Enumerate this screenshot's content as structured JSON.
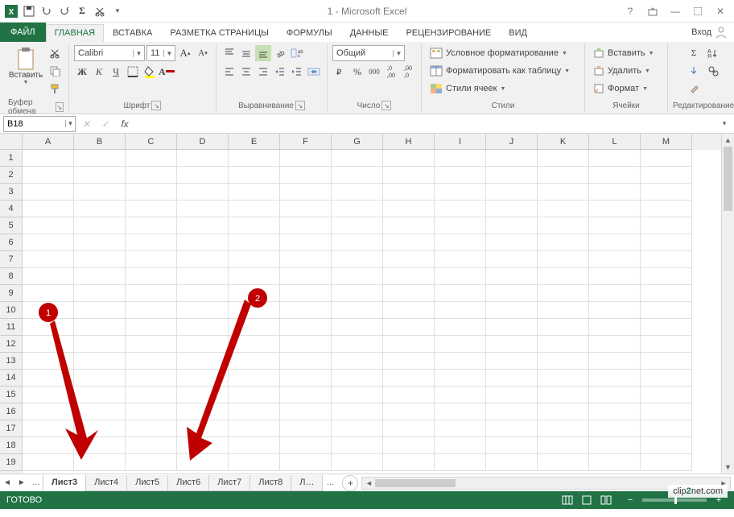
{
  "title": "1 - Microsoft Excel",
  "signin": "Вход",
  "tabs": {
    "file": "ФАЙЛ",
    "items": [
      "ГЛАВНАЯ",
      "ВСТАВКА",
      "РАЗМЕТКА СТРАНИЦЫ",
      "ФОРМУЛЫ",
      "ДАННЫЕ",
      "РЕЦЕНЗИРОВАНИЕ",
      "ВИД"
    ],
    "active": 0
  },
  "ribbon": {
    "clipboard": {
      "paste": "Вставить",
      "label": "Буфер обмена"
    },
    "font": {
      "name": "Calibri",
      "size": "11",
      "bold": "Ж",
      "italic": "К",
      "underline": "Ч",
      "label": "Шрифт"
    },
    "align": {
      "label": "Выравнивание"
    },
    "number": {
      "format": "Общий",
      "label": "Число"
    },
    "styles": {
      "cond": "Условное форматирование",
      "table": "Форматировать как таблицу",
      "cell": "Стили ячеек",
      "label": "Стили"
    },
    "cells": {
      "insert": "Вставить",
      "delete": "Удалить",
      "format": "Формат",
      "label": "Ячейки"
    },
    "editing": {
      "label": "Редактирование"
    }
  },
  "namebox": "B18",
  "fx": "fx",
  "columns": [
    "A",
    "B",
    "C",
    "D",
    "E",
    "F",
    "G",
    "H",
    "I",
    "J",
    "K",
    "L",
    "M"
  ],
  "rows": [
    "1",
    "2",
    "3",
    "4",
    "5",
    "6",
    "7",
    "8",
    "9",
    "10",
    "11",
    "12",
    "13",
    "14",
    "15",
    "16",
    "17",
    "18",
    "19"
  ],
  "sheets": {
    "ellipsis": "…",
    "tabs": [
      "Лист3",
      "Лист4",
      "Лист5",
      "Лист6",
      "Лист7",
      "Лист8",
      "Л…"
    ],
    "active": 0
  },
  "status": {
    "ready": "ГОТОВО",
    "zoom": "+"
  },
  "annotations": {
    "a1": "1",
    "a2": "2"
  },
  "watermark": {
    "pre": "clip",
    "mid": "2",
    "post": "net.com"
  }
}
